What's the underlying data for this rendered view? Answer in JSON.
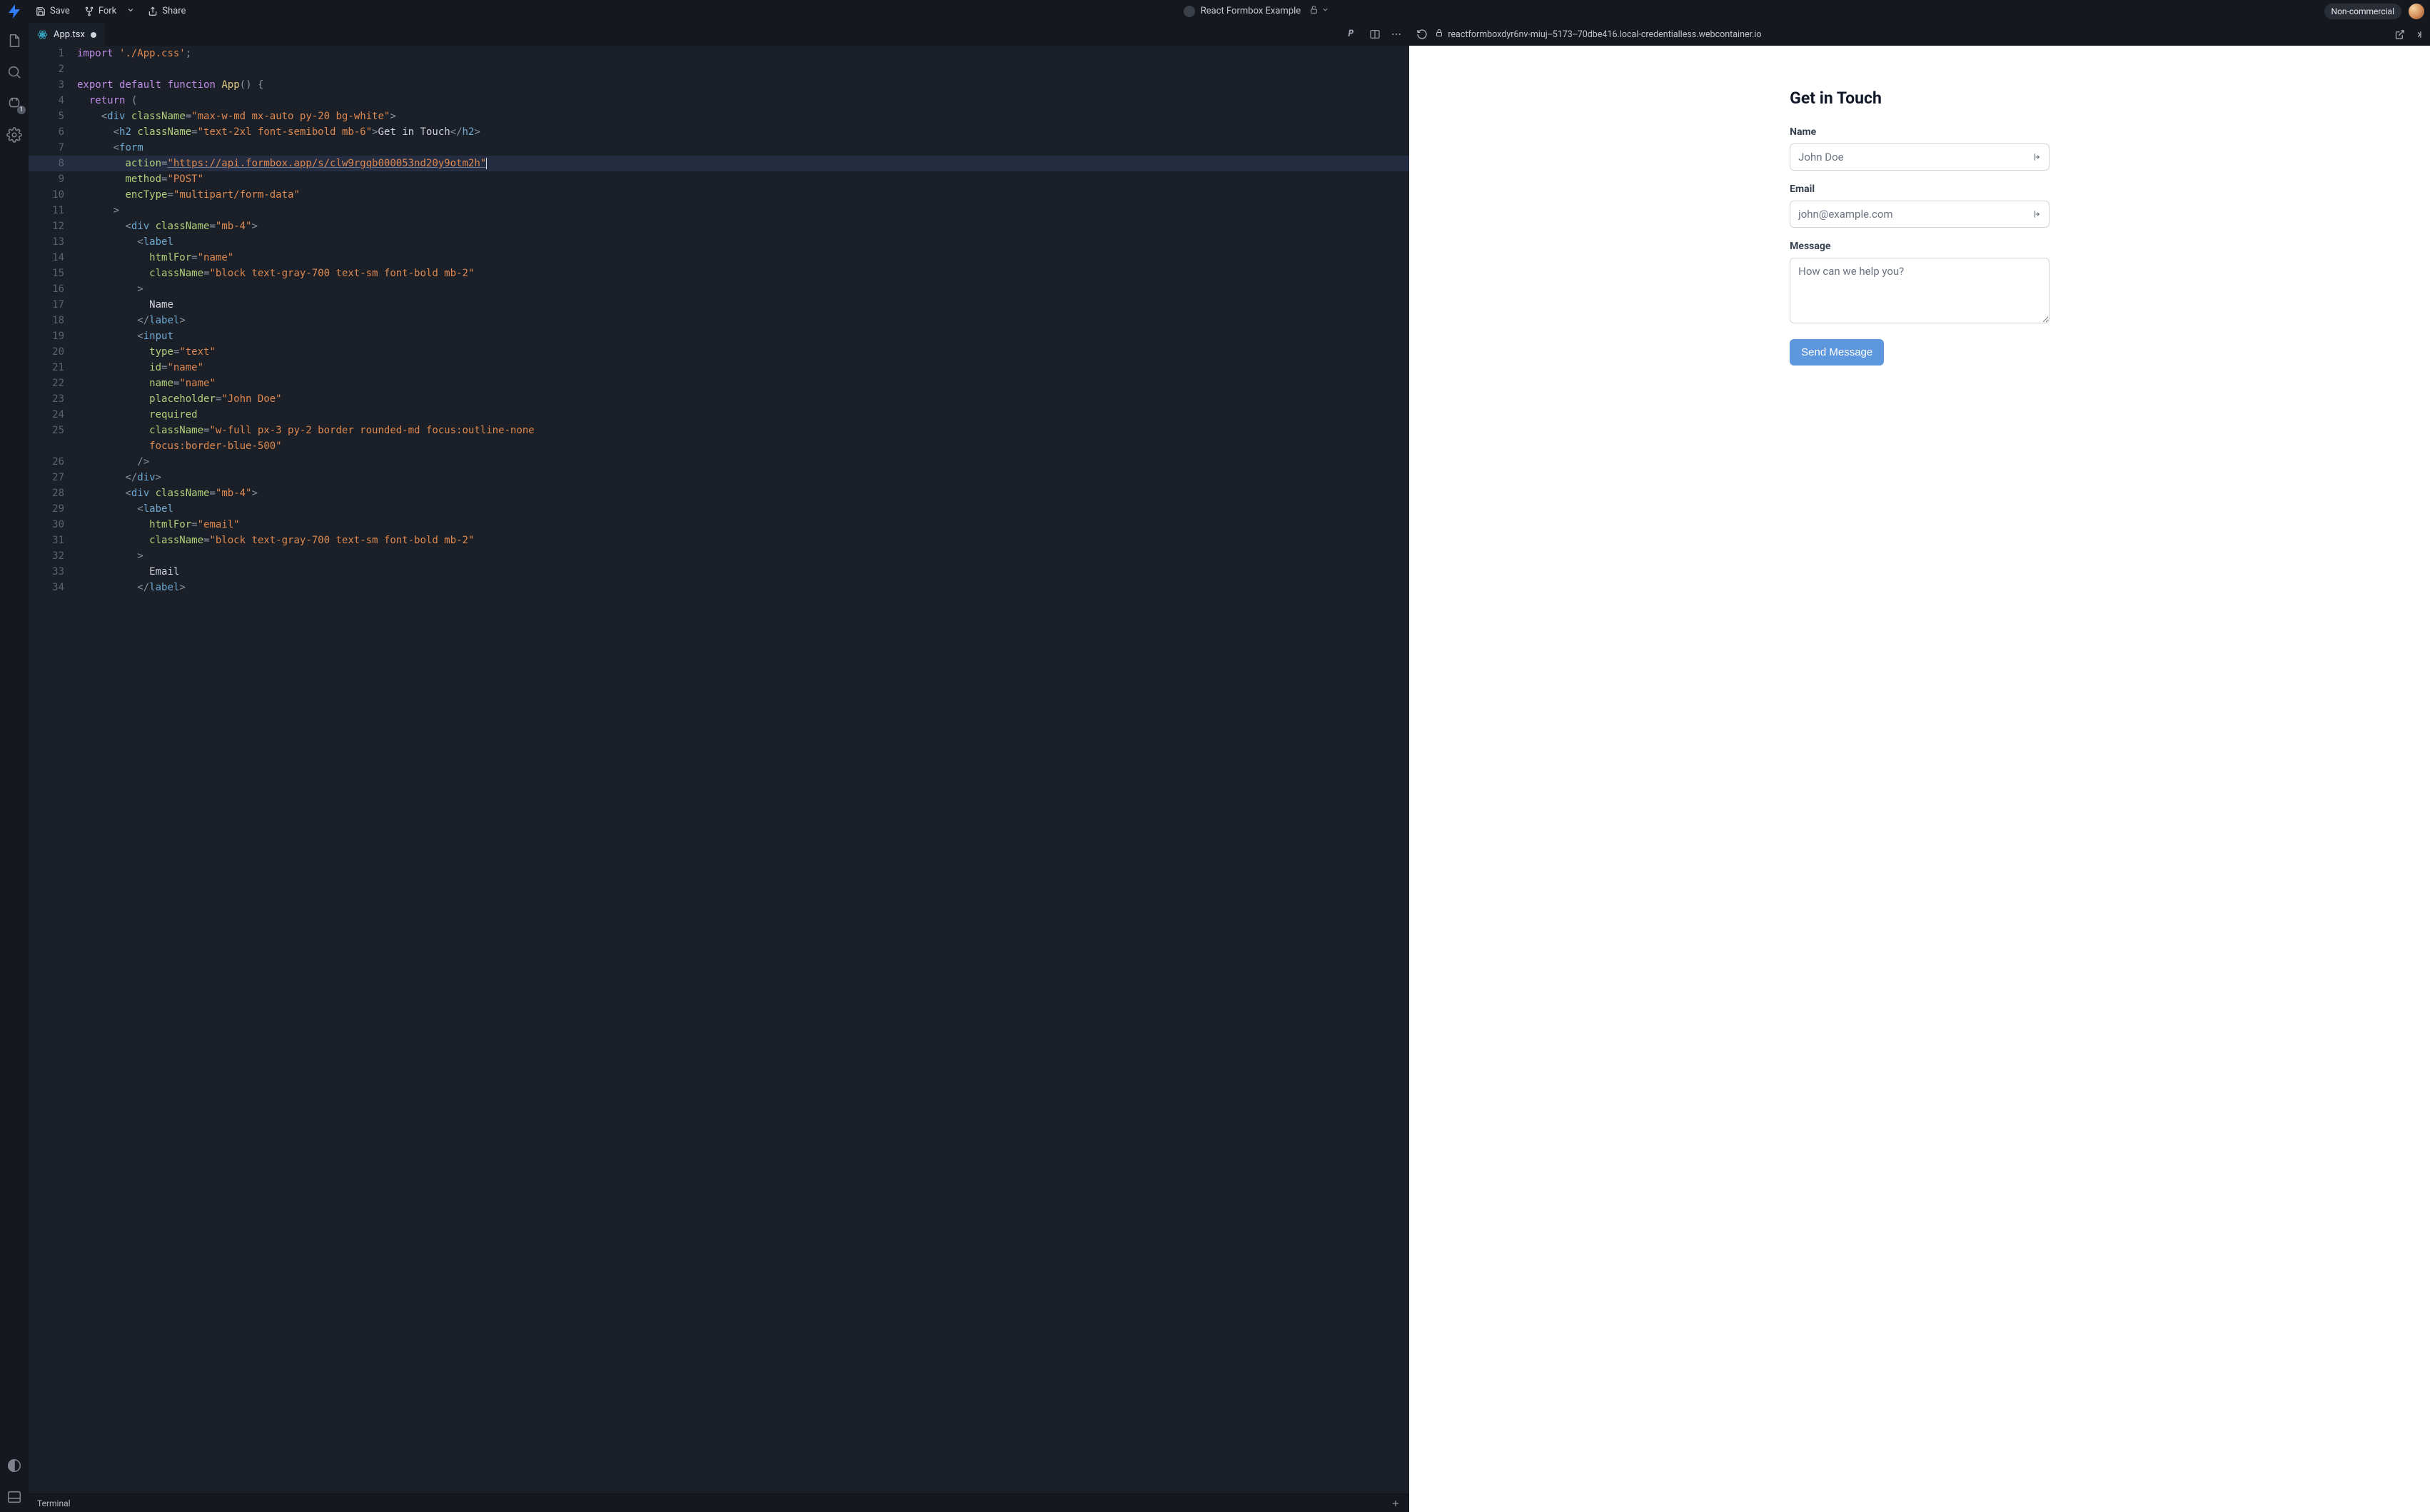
{
  "topbar": {
    "save": "Save",
    "fork": "Fork",
    "share": "Share",
    "project_name": "React Formbox Example",
    "badge": "Non-commercial"
  },
  "activity": {
    "port_badge": "1"
  },
  "tab": {
    "filename": "App.tsx"
  },
  "preview": {
    "url": "reactformboxdyr6nv-miuj--5173--70dbe416.local-credentialless.webcontainer.io",
    "form": {
      "heading": "Get in Touch",
      "name_label": "Name",
      "name_placeholder": "John Doe",
      "email_label": "Email",
      "email_placeholder": "john@example.com",
      "message_label": "Message",
      "message_placeholder": "How can we help you?",
      "submit": "Send Message"
    }
  },
  "terminal": {
    "label": "Terminal"
  },
  "code": {
    "lines": [
      {
        "n": 1,
        "seg": [
          [
            "kw",
            "import"
          ],
          [
            "plain",
            " "
          ],
          [
            "str",
            "'./App.css'"
          ],
          [
            "punc",
            ";"
          ]
        ]
      },
      {
        "n": 2,
        "seg": [
          [
            "plain",
            ""
          ]
        ]
      },
      {
        "n": 3,
        "seg": [
          [
            "kw",
            "export"
          ],
          [
            "plain",
            " "
          ],
          [
            "kw",
            "default"
          ],
          [
            "plain",
            " "
          ],
          [
            "kw",
            "function"
          ],
          [
            "plain",
            " "
          ],
          [
            "func",
            "App"
          ],
          [
            "punc",
            "()"
          ],
          [
            "plain",
            " "
          ],
          [
            "punc",
            "{"
          ]
        ]
      },
      {
        "n": 4,
        "seg": [
          [
            "plain",
            "  "
          ],
          [
            "kw",
            "return"
          ],
          [
            "plain",
            " "
          ],
          [
            "punc",
            "("
          ]
        ]
      },
      {
        "n": 5,
        "seg": [
          [
            "plain",
            "    "
          ],
          [
            "punc",
            "<"
          ],
          [
            "tag",
            "div"
          ],
          [
            "plain",
            " "
          ],
          [
            "attr",
            "className"
          ],
          [
            "punc",
            "="
          ],
          [
            "str",
            "\"max-w-md mx-auto py-20 bg-white\""
          ],
          [
            "punc",
            ">"
          ]
        ]
      },
      {
        "n": 6,
        "seg": [
          [
            "plain",
            "      "
          ],
          [
            "punc",
            "<"
          ],
          [
            "tag",
            "h2"
          ],
          [
            "plain",
            " "
          ],
          [
            "attr",
            "className"
          ],
          [
            "punc",
            "="
          ],
          [
            "str",
            "\"text-2xl font-semibold mb-6\""
          ],
          [
            "punc",
            ">"
          ],
          [
            "text",
            "Get in Touch"
          ],
          [
            "punc",
            "</"
          ],
          [
            "tag",
            "h2"
          ],
          [
            "punc",
            ">"
          ]
        ]
      },
      {
        "n": 7,
        "seg": [
          [
            "plain",
            "      "
          ],
          [
            "punc",
            "<"
          ],
          [
            "tag",
            "form"
          ]
        ]
      },
      {
        "n": 8,
        "hl": true,
        "cursor": true,
        "seg": [
          [
            "plain",
            "        "
          ],
          [
            "attr",
            "action"
          ],
          [
            "punc",
            "="
          ],
          [
            "str-u",
            "\"https://api.formbox.app/s/clw9rgqb000053nd20y9otm2h\""
          ]
        ]
      },
      {
        "n": 9,
        "seg": [
          [
            "plain",
            "        "
          ],
          [
            "attr",
            "method"
          ],
          [
            "punc",
            "="
          ],
          [
            "str",
            "\"POST\""
          ]
        ]
      },
      {
        "n": 10,
        "seg": [
          [
            "plain",
            "        "
          ],
          [
            "attr",
            "encType"
          ],
          [
            "punc",
            "="
          ],
          [
            "str",
            "\"multipart/form-data\""
          ]
        ]
      },
      {
        "n": 11,
        "seg": [
          [
            "plain",
            "      "
          ],
          [
            "punc",
            ">"
          ]
        ]
      },
      {
        "n": 12,
        "seg": [
          [
            "plain",
            "        "
          ],
          [
            "punc",
            "<"
          ],
          [
            "tag",
            "div"
          ],
          [
            "plain",
            " "
          ],
          [
            "attr",
            "className"
          ],
          [
            "punc",
            "="
          ],
          [
            "str",
            "\"mb-4\""
          ],
          [
            "punc",
            ">"
          ]
        ]
      },
      {
        "n": 13,
        "seg": [
          [
            "plain",
            "          "
          ],
          [
            "punc",
            "<"
          ],
          [
            "tag",
            "label"
          ]
        ]
      },
      {
        "n": 14,
        "seg": [
          [
            "plain",
            "            "
          ],
          [
            "attr",
            "htmlFor"
          ],
          [
            "punc",
            "="
          ],
          [
            "str",
            "\"name\""
          ]
        ]
      },
      {
        "n": 15,
        "seg": [
          [
            "plain",
            "            "
          ],
          [
            "attr",
            "className"
          ],
          [
            "punc",
            "="
          ],
          [
            "str",
            "\"block text-gray-700 text-sm font-bold mb-2\""
          ]
        ]
      },
      {
        "n": 16,
        "seg": [
          [
            "plain",
            "          "
          ],
          [
            "punc",
            ">"
          ]
        ]
      },
      {
        "n": 17,
        "seg": [
          [
            "plain",
            "            "
          ],
          [
            "text",
            "Name"
          ]
        ]
      },
      {
        "n": 18,
        "seg": [
          [
            "plain",
            "          "
          ],
          [
            "punc",
            "</"
          ],
          [
            "tag",
            "label"
          ],
          [
            "punc",
            ">"
          ]
        ]
      },
      {
        "n": 19,
        "seg": [
          [
            "plain",
            "          "
          ],
          [
            "punc",
            "<"
          ],
          [
            "tag",
            "input"
          ]
        ]
      },
      {
        "n": 20,
        "seg": [
          [
            "plain",
            "            "
          ],
          [
            "attr",
            "type"
          ],
          [
            "punc",
            "="
          ],
          [
            "str",
            "\"text\""
          ]
        ]
      },
      {
        "n": 21,
        "seg": [
          [
            "plain",
            "            "
          ],
          [
            "attr",
            "id"
          ],
          [
            "punc",
            "="
          ],
          [
            "str",
            "\"name\""
          ]
        ]
      },
      {
        "n": 22,
        "seg": [
          [
            "plain",
            "            "
          ],
          [
            "attr",
            "name"
          ],
          [
            "punc",
            "="
          ],
          [
            "str",
            "\"name\""
          ]
        ]
      },
      {
        "n": 23,
        "seg": [
          [
            "plain",
            "            "
          ],
          [
            "attr",
            "placeholder"
          ],
          [
            "punc",
            "="
          ],
          [
            "str",
            "\"John Doe\""
          ]
        ]
      },
      {
        "n": 24,
        "seg": [
          [
            "plain",
            "            "
          ],
          [
            "attr",
            "required"
          ]
        ]
      },
      {
        "n": 25,
        "seg": [
          [
            "plain",
            "            "
          ],
          [
            "attr",
            "className"
          ],
          [
            "punc",
            "="
          ],
          [
            "str",
            "\"w-full px-3 py-2 border rounded-md focus:outline-none "
          ]
        ]
      },
      {
        "n": 0,
        "seg": [
          [
            "plain",
            "            "
          ],
          [
            "str",
            "focus:border-blue-500\""
          ]
        ]
      },
      {
        "n": 26,
        "seg": [
          [
            "plain",
            "          "
          ],
          [
            "punc",
            "/>"
          ]
        ]
      },
      {
        "n": 27,
        "seg": [
          [
            "plain",
            "        "
          ],
          [
            "punc",
            "</"
          ],
          [
            "tag",
            "div"
          ],
          [
            "punc",
            ">"
          ]
        ]
      },
      {
        "n": 28,
        "seg": [
          [
            "plain",
            "        "
          ],
          [
            "punc",
            "<"
          ],
          [
            "tag",
            "div"
          ],
          [
            "plain",
            " "
          ],
          [
            "attr",
            "className"
          ],
          [
            "punc",
            "="
          ],
          [
            "str",
            "\"mb-4\""
          ],
          [
            "punc",
            ">"
          ]
        ]
      },
      {
        "n": 29,
        "seg": [
          [
            "plain",
            "          "
          ],
          [
            "punc",
            "<"
          ],
          [
            "tag",
            "label"
          ]
        ]
      },
      {
        "n": 30,
        "seg": [
          [
            "plain",
            "            "
          ],
          [
            "attr",
            "htmlFor"
          ],
          [
            "punc",
            "="
          ],
          [
            "str",
            "\"email\""
          ]
        ]
      },
      {
        "n": 31,
        "seg": [
          [
            "plain",
            "            "
          ],
          [
            "attr",
            "className"
          ],
          [
            "punc",
            "="
          ],
          [
            "str",
            "\"block text-gray-700 text-sm font-bold mb-2\""
          ]
        ]
      },
      {
        "n": 32,
        "seg": [
          [
            "plain",
            "          "
          ],
          [
            "punc",
            ">"
          ]
        ]
      },
      {
        "n": 33,
        "seg": [
          [
            "plain",
            "            "
          ],
          [
            "text",
            "Email"
          ]
        ]
      },
      {
        "n": 34,
        "seg": [
          [
            "plain",
            "          "
          ],
          [
            "punc",
            "</"
          ],
          [
            "tag",
            "label"
          ],
          [
            "punc",
            ">"
          ]
        ]
      }
    ]
  }
}
